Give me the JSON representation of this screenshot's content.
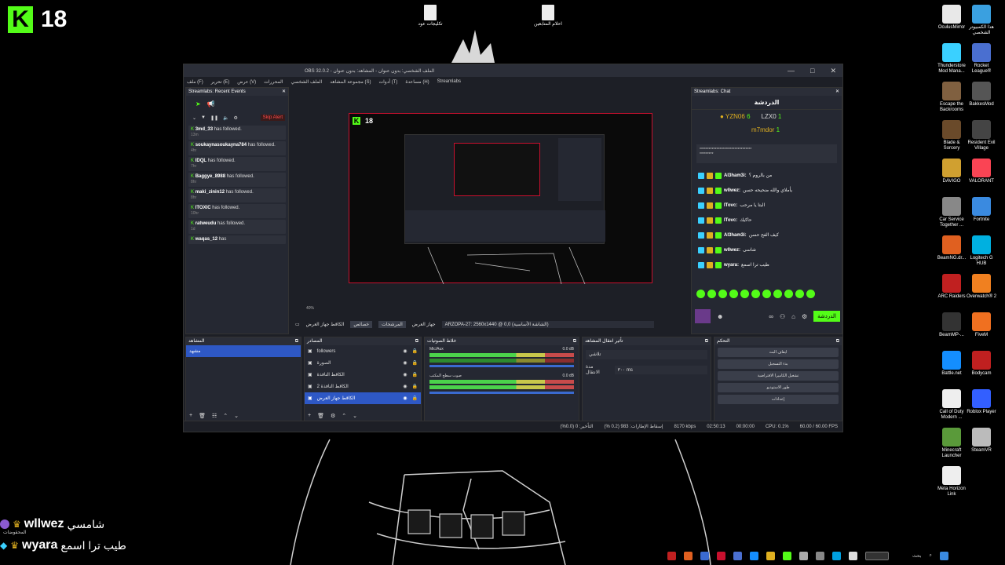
{
  "overlay_logo": {
    "letter": "K",
    "number": "18"
  },
  "desktop_files": [
    {
      "label": "تكليجات عود"
    },
    {
      "label": "احلام المتابعين"
    }
  ],
  "desktop_icons": [
    {
      "label": "OculusMirror",
      "color": "#e8e8e8"
    },
    {
      "label": "هذا الكمبيوتر الشخصي",
      "color": "#3aa0e0"
    },
    {
      "label": "Thunderstore Mod Mana...",
      "color": "#3ad0ff"
    },
    {
      "label": "Rocket League®",
      "color": "#4a6fd0"
    },
    {
      "label": "Escape the Backrooms",
      "color": "#806040"
    },
    {
      "label": "BakkesMod",
      "color": "#555"
    },
    {
      "label": "Blade & Sorcery",
      "color": "#6a4a2a"
    },
    {
      "label": "Resident Evil Village",
      "color": "#444"
    },
    {
      "label": "DAVIGO",
      "color": "#d0a030"
    },
    {
      "label": "VALORANT",
      "color": "#fa4454"
    },
    {
      "label": "Car Service Together ...",
      "color": "#888"
    },
    {
      "label": "Fortnite",
      "color": "#3a8ae0"
    },
    {
      "label": "BeamNG.dr...",
      "color": "#e06020"
    },
    {
      "label": "Logitech G HUB",
      "color": "#00b0e0"
    },
    {
      "label": "ARC Raiders",
      "color": "#c02020"
    },
    {
      "label": "Overwatch® 2",
      "color": "#f08020"
    },
    {
      "label": "BeamMP-...",
      "color": "#333"
    },
    {
      "label": "FiveM",
      "color": "#f07020"
    },
    {
      "label": "Battle.net",
      "color": "#148eff"
    },
    {
      "label": "Bodycam",
      "color": "#c02020"
    },
    {
      "label": "Call of Duty Modern ...",
      "color": "#eee"
    },
    {
      "label": "Roblox Player",
      "color": "#335fff"
    },
    {
      "label": "Minecraft Launcher",
      "color": "#5a9a3a"
    },
    {
      "label": "SteamVR",
      "color": "#bbb"
    },
    {
      "label": "Meta Horizon Link",
      "color": "#eee"
    }
  ],
  "obs": {
    "title": "OBS 32.0.2 - الملف الشخصي: بدون عنوان - المشاهد: بدون عنوان",
    "menu": [
      "ملف (F)",
      "تحرير (E)",
      "عرض (V)",
      "المحررات",
      "الملف الشخصي",
      "مجموعة المشاهد (S)",
      "أدوات (T)",
      "مساعدة (H)",
      "Streamlabs"
    ],
    "recent_events": {
      "title": "Streamlabs: Recent Events",
      "skip_alert": "Skip Alert",
      "events": [
        {
          "user": "3md_33",
          "text": "has followed.",
          "time": "13m"
        },
        {
          "user": "soukaynasoukayna784",
          "text": "has followed.",
          "time": "4hr"
        },
        {
          "user": "IDQL",
          "text": "has followed.",
          "time": "7hr"
        },
        {
          "user": "Baggye_8988",
          "text": "has followed.",
          "time": "8hr"
        },
        {
          "user": "maki_zinin12",
          "text": "has followed.",
          "time": "8hr"
        },
        {
          "user": "ITOXIC",
          "text": "has followed.",
          "time": "10hr"
        },
        {
          "user": "ratweudu",
          "text": "has followed.",
          "time": "1d"
        },
        {
          "user": "waqas_12",
          "text": "has",
          "time": ""
        }
      ]
    },
    "preview_toolbar": {
      "zoom": "40%",
      "label1": "الكاقط جهاز العرض",
      "props": "خصائص",
      "filters": "المرشحات",
      "display": "جهاز العرض",
      "monitor": "ARZOPA-27: 2560x1440 @ 0,0 (الشاشة الأساسية)"
    },
    "chat": {
      "title": "Streamlabs: Chat",
      "header": "الدردشة",
      "top": [
        {
          "name": "YZN06",
          "count": "6"
        },
        {
          "name": "LZX0",
          "count": "1"
        },
        {
          "name": "m7mdor",
          "count": "1"
        }
      ],
      "messages": [
        {
          "user": "Al3ham3i:",
          "text": "من بالروم ؟"
        },
        {
          "user": "wllwez:",
          "text": "يأملاي والله ضحيحه حسن"
        },
        {
          "user": "ITovc:",
          "text": "البتا يا مرحب"
        },
        {
          "user": "ITovc:",
          "text": "حاكيك"
        },
        {
          "user": "Al3ham3i:",
          "text": "كيف الفح حسن"
        },
        {
          "user": "wllwez:",
          "text": "شاسى"
        },
        {
          "user": "wyara:",
          "text": "طيب ترا اسمع"
        }
      ],
      "send_label": "الدردشة"
    },
    "scenes": {
      "title": "المشاهد",
      "items": [
        "مشهد"
      ]
    },
    "sources": {
      "title": "المصادر",
      "items": [
        "followers",
        "الصورة",
        "الكاقط النافذة",
        "الكاقط النافذة 2",
        "الكاقط جهاز العرض"
      ]
    },
    "mixer": {
      "title": "خلاط الصوتيات",
      "channels": [
        {
          "name": "Mic/Aux",
          "db": "0.0 dB"
        },
        {
          "name": "صوت سطح المكتب",
          "db": "0.0 dB"
        }
      ]
    },
    "transitions": {
      "title": "تأثير انتقال المشاهد",
      "type": "تلاشي",
      "duration_label": "مدة الانتقال",
      "duration": "٣٠٠ ms"
    },
    "controls": {
      "title": "التحكم",
      "buttons": [
        "ايقاف البث",
        "بدء التسجيل",
        "تشغيل الكاميرا الافتراضية",
        "طور الاستوديو",
        "إعدادات"
      ]
    },
    "status": {
      "frames": "التأخير: 0 (0.0%)",
      "dropped": "إسقاط الإطارات: 983 (0.2 %)",
      "bitrate": "8170 kbps",
      "live_time": "02:50:13",
      "rec_time": "00:00:00",
      "cpu": "CPU: 0.1%",
      "fps": "60.00 / 60.00 FPS"
    }
  },
  "overlay_chat": [
    {
      "user": "wllwez",
      "msg": "شامسي",
      "sub": "المحقوضات"
    },
    {
      "user": "wyara",
      "msg": "طيب ترا اسمع",
      "sub": ""
    }
  ],
  "taskbar": {
    "search": "بحث"
  }
}
